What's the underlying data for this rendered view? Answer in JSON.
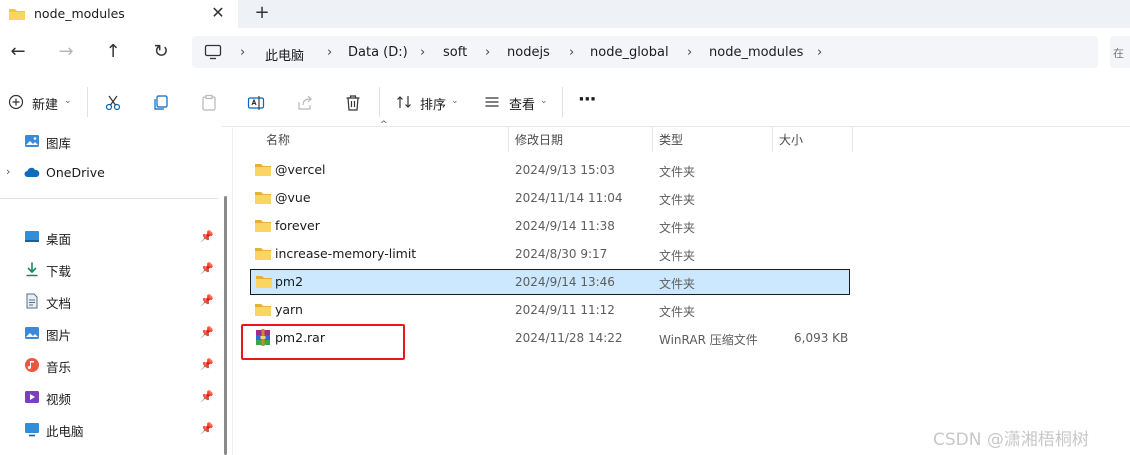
{
  "tab": {
    "title": "node_modules",
    "close": "✕",
    "new_tab": "+"
  },
  "nav": {
    "back": "←",
    "forward": "→",
    "up": "↑",
    "refresh": "↻"
  },
  "breadcrumb": [
    "此电脑",
    "Data (D:)",
    "soft",
    "nodejs",
    "node_global",
    "node_modules"
  ],
  "breadcrumb_sep": "›",
  "search": {
    "text": "在"
  },
  "toolbar": {
    "new_label": "新建",
    "sort_label": "排序",
    "view_label": "查看",
    "more": "···"
  },
  "sidebar": {
    "top_items": [
      {
        "label": "图库",
        "icon": "gallery-icon"
      },
      {
        "label": "OneDrive",
        "icon": "onedrive-icon"
      }
    ],
    "pinned_items": [
      {
        "label": "桌面",
        "icon": "desktop-icon"
      },
      {
        "label": "下载",
        "icon": "download-icon"
      },
      {
        "label": "文档",
        "icon": "document-icon"
      },
      {
        "label": "图片",
        "icon": "pictures-icon"
      },
      {
        "label": "音乐",
        "icon": "music-icon"
      },
      {
        "label": "视频",
        "icon": "video-icon"
      },
      {
        "label": "此电脑",
        "icon": "this-pc-icon"
      }
    ]
  },
  "columns": {
    "name": "名称",
    "modified": "修改日期",
    "type": "类型",
    "size": "大小"
  },
  "files": [
    {
      "name": "@vercel",
      "modified": "2024/9/13 15:03",
      "type": "文件夹",
      "size": "",
      "icon": "folder-icon"
    },
    {
      "name": "@vue",
      "modified": "2024/11/14 11:04",
      "type": "文件夹",
      "size": "",
      "icon": "folder-icon"
    },
    {
      "name": "forever",
      "modified": "2024/9/14 11:38",
      "type": "文件夹",
      "size": "",
      "icon": "folder-icon"
    },
    {
      "name": "increase-memory-limit",
      "modified": "2024/8/30 9:17",
      "type": "文件夹",
      "size": "",
      "icon": "folder-icon"
    },
    {
      "name": "pm2",
      "modified": "2024/9/14 13:46",
      "type": "文件夹",
      "size": "",
      "icon": "folder-icon",
      "selected": true
    },
    {
      "name": "yarn",
      "modified": "2024/9/11 11:12",
      "type": "文件夹",
      "size": "",
      "icon": "folder-icon"
    },
    {
      "name": "pm2.rar",
      "modified": "2024/11/28 14:22",
      "type": "WinRAR 压缩文件",
      "size": "6,093 KB",
      "icon": "winrar-archive-icon"
    }
  ],
  "watermark": "CSDN @潇湘梧桐树",
  "colors": {
    "accent": "#0078d4",
    "selection": "#cce8ff",
    "highlight_box": "#e81818",
    "folder": "#f4c542"
  }
}
